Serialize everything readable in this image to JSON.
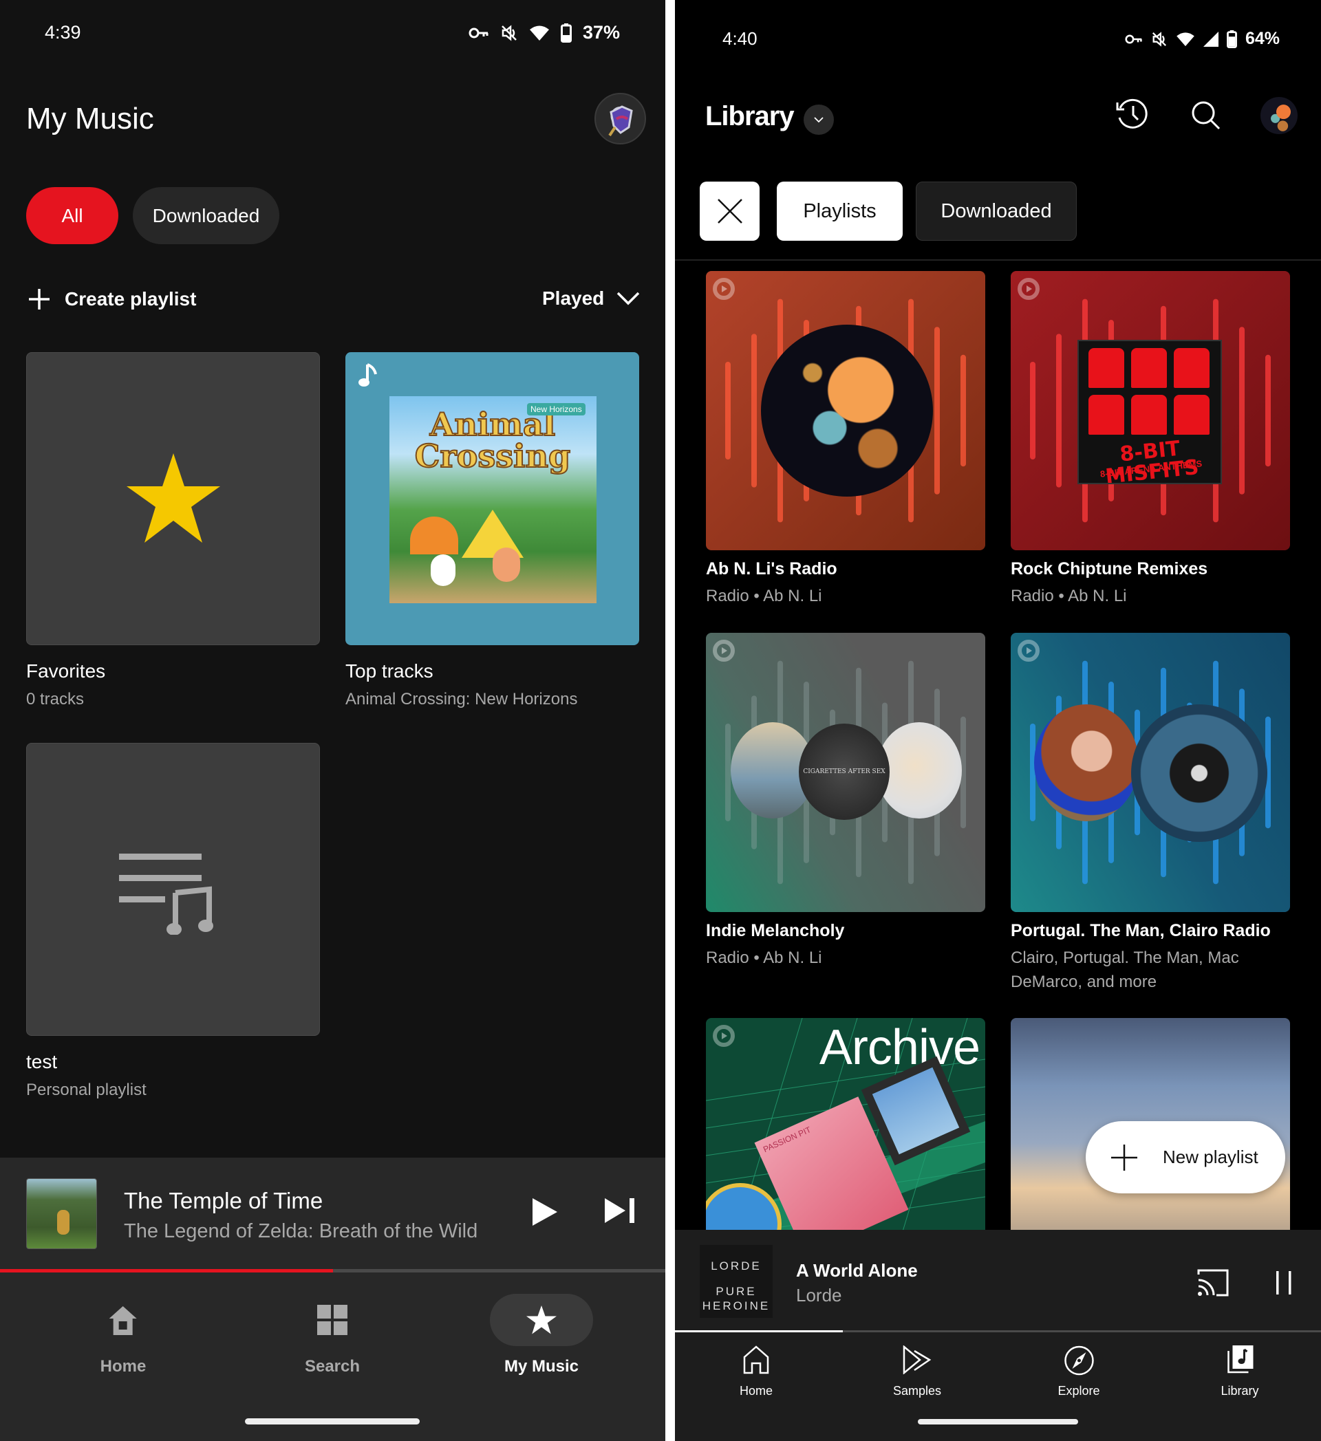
{
  "left": {
    "status": {
      "time": "4:39",
      "battery": "37%",
      "icons": [
        "vpn-key-icon",
        "mute-icon",
        "wifi-icon",
        "battery-icon"
      ]
    },
    "header": {
      "title": "My Music",
      "avatar": "zelda-shield-avatar"
    },
    "filters": [
      {
        "label": "All",
        "selected": true
      },
      {
        "label": "Downloaded",
        "selected": false
      }
    ],
    "toolbar": {
      "create_label": "Create playlist",
      "sort_label": "Played"
    },
    "playlists": [
      {
        "title": "Favorites",
        "subtitle": "0 tracks",
        "art": "star-icon"
      },
      {
        "title": "Top tracks",
        "subtitle": "Animal Crossing: New Horizons",
        "art": "animal-crossing-cover",
        "art_text_1": "Animal",
        "art_text_2": "Crossing",
        "art_badge": "New Horizons"
      },
      {
        "title": "test",
        "subtitle": "Personal playlist",
        "art": "playlist-music-icon"
      }
    ],
    "player": {
      "title": "The Temple of Time",
      "subtitle": "The Legend of Zelda: Breath of the Wild",
      "progress": 0.5
    },
    "nav": [
      {
        "label": "Home",
        "icon": "home-icon",
        "active": false
      },
      {
        "label": "Search",
        "icon": "grid-icon",
        "active": false
      },
      {
        "label": "My Music",
        "icon": "star-icon",
        "active": true
      }
    ],
    "colors": {
      "accent": "#e5141f",
      "star": "#f5c800",
      "chip_bg": "#272727",
      "card_bg": "#3d3d3d",
      "top_tracks_bg": "#4c9ab4"
    }
  },
  "right": {
    "status": {
      "time": "4:40",
      "battery": "64%",
      "icons": [
        "vpn-key-icon",
        "mute-icon",
        "wifi-icon",
        "signal-icon",
        "battery-icon"
      ]
    },
    "header": {
      "title": "Library"
    },
    "filters": [
      {
        "label": "Playlists",
        "selected": true
      },
      {
        "label": "Downloaded",
        "selected": false
      }
    ],
    "grid": [
      {
        "title": "Ab N. Li's Radio",
        "subtitle": "Radio • Ab N. Li",
        "theme": "#b3432a"
      },
      {
        "title": "Rock Chiptune Remixes",
        "subtitle": "Radio • Ab N. Li",
        "theme": "#a01d21",
        "art_text_1": "8-BIT MISFITS",
        "art_text_2": "8-BIT ARENA ANTHEMS"
      },
      {
        "title": "Indie Melancholy",
        "subtitle": "Radio • Ab N. Li",
        "theme": "#555555",
        "art_text_1": "CIGARETTES AFTER SEX"
      },
      {
        "title": "Portugal. The Man, Clairo Radio",
        "subtitle": "Clairo, Portugal. The Man, Mac DeMarco, and more",
        "theme": "#1a5f7a"
      },
      {
        "title": "",
        "subtitle": "",
        "theme": "#0d4a35",
        "art_text_1": "Archive",
        "art_text_2": "PASSION PIT"
      },
      {
        "title": "",
        "subtitle": "",
        "theme": "#6b86a8"
      }
    ],
    "fab": {
      "label": "New playlist"
    },
    "player": {
      "title": "A World Alone",
      "subtitle": "Lorde",
      "art_line1": "LORDE",
      "art_line2": "PURE",
      "art_line3": "HEROINE",
      "progress": 0.26
    },
    "nav": [
      {
        "label": "Home",
        "icon": "home-outline-icon"
      },
      {
        "label": "Samples",
        "icon": "samples-icon"
      },
      {
        "label": "Explore",
        "icon": "compass-icon"
      },
      {
        "label": "Library",
        "icon": "library-icon",
        "active": true
      }
    ]
  }
}
